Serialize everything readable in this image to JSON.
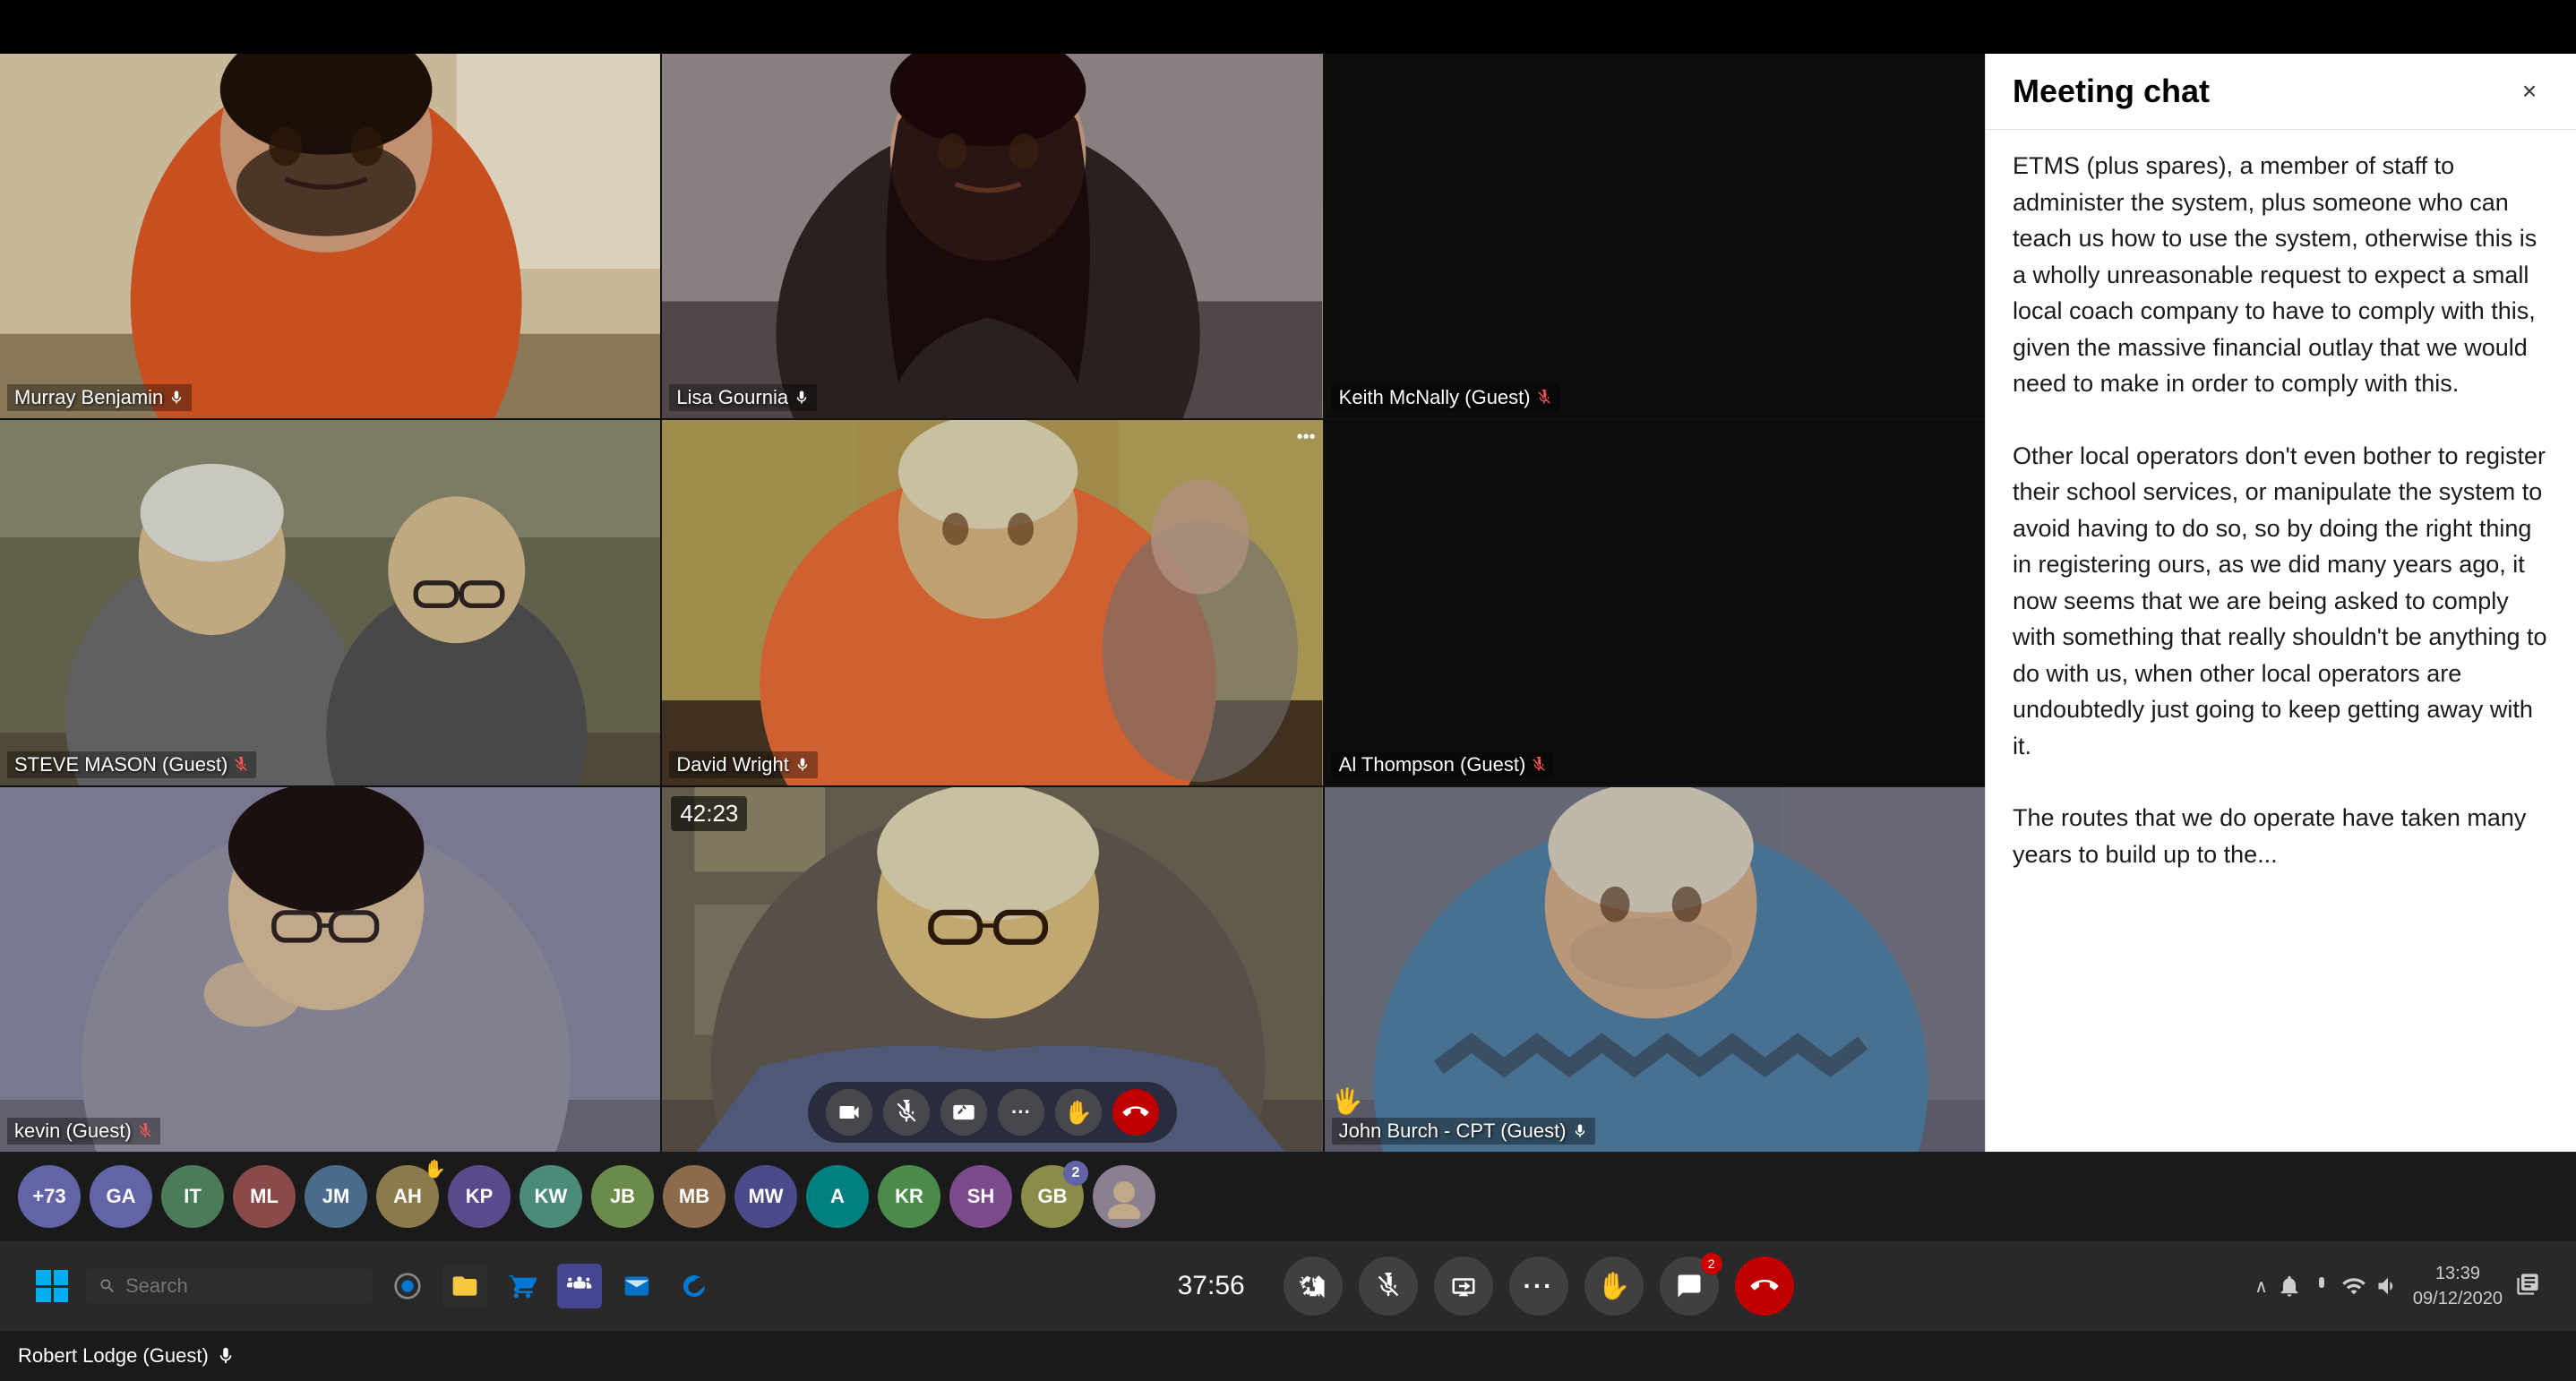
{
  "topBar": {},
  "videoGrid": {
    "cells": [
      {
        "id": "cell-1",
        "name": "Murray Benjamin",
        "muted": false,
        "hasVideo": true,
        "colorClass": "video-cell-1",
        "darkBg": false
      },
      {
        "id": "cell-2",
        "name": "Lisa Gournia",
        "muted": false,
        "hasVideo": true,
        "colorClass": "video-cell-2",
        "darkBg": false
      },
      {
        "id": "cell-3",
        "name": "Keith McNally (Guest)",
        "muted": true,
        "hasVideo": false,
        "colorClass": "video-cell-3",
        "darkBg": true
      },
      {
        "id": "cell-4",
        "name": "STEVE MASON (Guest)",
        "muted": true,
        "hasVideo": true,
        "colorClass": "video-cell-4",
        "darkBg": false
      },
      {
        "id": "cell-5",
        "name": "David Wright",
        "muted": false,
        "hasVideo": true,
        "colorClass": "video-cell-5",
        "darkBg": false,
        "hasOptions": true
      },
      {
        "id": "cell-6",
        "name": "Al Thompson (Guest)",
        "muted": true,
        "hasVideo": false,
        "colorClass": "video-cell-6",
        "darkBg": true
      },
      {
        "id": "cell-7",
        "name": "kevin (Guest)",
        "muted": true,
        "hasVideo": true,
        "colorClass": "video-cell-7",
        "darkBg": false
      },
      {
        "id": "cell-8",
        "name": "",
        "muted": false,
        "hasVideo": true,
        "colorClass": "video-cell-8",
        "darkBg": false,
        "timer": "42:23",
        "isCenter": true
      },
      {
        "id": "cell-9",
        "name": "John Burch - CPT (Guest)",
        "muted": false,
        "hasVideo": true,
        "colorClass": "video-cell-9",
        "darkBg": false,
        "hasHandRaise": true
      }
    ]
  },
  "chatPanel": {
    "title": "Meeting chat",
    "closeLabel": "×",
    "messages": [
      {
        "id": "msg-1",
        "text": "ETMS (plus spares), a member of staff to administer the system, plus someone who can teach us how to use the system, otherwise this is a wholly unreasonable request to expect a small local coach company to have to comply with this, given the massive financial outlay that we would need to make in order to comply with this."
      },
      {
        "id": "msg-2",
        "text": "Other local operators don't even bother to register their school services, or manipulate the system to avoid having to do so, so by doing the right thing in registering ours, as we did many years ago, it now seems that we are being asked to comply with something that really shouldn't be anything to do with us, when other local operators are undoubtedly just going to keep getting away with it."
      },
      {
        "id": "msg-3",
        "text": "The routes that we do operate have taken many years to build up to the..."
      }
    ]
  },
  "meetingControls": {
    "timer": "37:56",
    "buttons": [
      {
        "id": "btn-camera",
        "icon": "📷",
        "label": "Camera",
        "active": false
      },
      {
        "id": "btn-mic",
        "icon": "🎤",
        "label": "Mic",
        "active": false,
        "muted": true
      },
      {
        "id": "btn-share",
        "icon": "↑",
        "label": "Share",
        "active": false
      },
      {
        "id": "btn-more",
        "icon": "•••",
        "label": "More",
        "active": false
      },
      {
        "id": "btn-hand",
        "icon": "✋",
        "label": "Hand",
        "active": false
      },
      {
        "id": "btn-chat",
        "icon": "💬",
        "label": "Chat",
        "active": false,
        "badge": "2"
      },
      {
        "id": "btn-end",
        "icon": "📞",
        "label": "End",
        "active": true,
        "red": true
      }
    ]
  },
  "participantBar": {
    "overflowCount": "+73",
    "participants": [
      {
        "id": "p-ga",
        "initials": "GA",
        "color": "#6264a7"
      },
      {
        "id": "p-it",
        "initials": "IT",
        "color": "#4a7c59"
      },
      {
        "id": "p-ml",
        "initials": "ML",
        "color": "#8b4a4a"
      },
      {
        "id": "p-jm",
        "initials": "JM",
        "color": "#4a6b8b"
      },
      {
        "id": "p-ah",
        "initials": "AH",
        "color": "#8b7a4a"
      },
      {
        "id": "p-kp",
        "initials": "KP",
        "color": "#5a4a8b"
      },
      {
        "id": "p-kw",
        "initials": "KW",
        "color": "#4a8b7a"
      },
      {
        "id": "p-jb",
        "initials": "JB",
        "color": "#6b8b4a"
      },
      {
        "id": "p-mb",
        "initials": "MB",
        "color": "#8b6b4a"
      },
      {
        "id": "p-mw",
        "initials": "MW",
        "color": "#4a4a8b"
      },
      {
        "id": "p-a",
        "initials": "A",
        "color": "#8b4a6b"
      },
      {
        "id": "p-kr",
        "initials": "KR",
        "color": "#4a8b4a"
      },
      {
        "id": "p-sh",
        "initials": "SH",
        "color": "#7a4a8b"
      },
      {
        "id": "p-gb",
        "initials": "GB",
        "color": "#8b8b4a"
      }
    ]
  },
  "statusBar": {
    "userLabel": "Robert Lodge (Guest)",
    "micIcon": "🎤",
    "time": "13:39",
    "date": "09/12/2020"
  },
  "taskbar": {
    "searchPlaceholder": "Search",
    "time": "13:39",
    "date": "09/12/2020"
  }
}
